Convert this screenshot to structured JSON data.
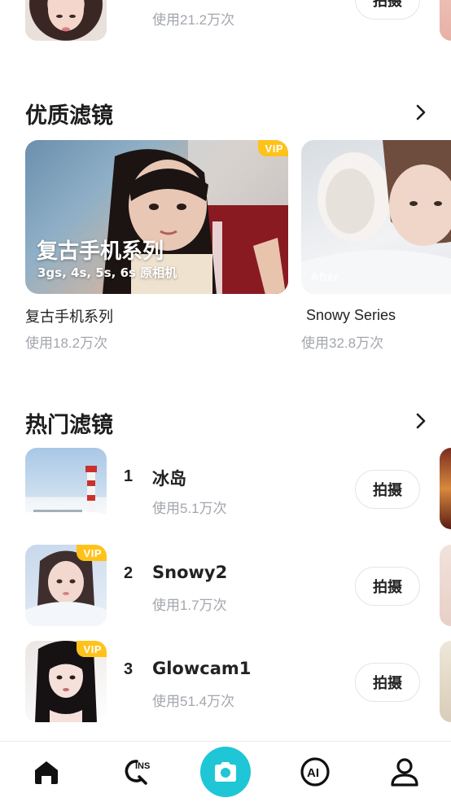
{
  "top_item": {
    "usage": "使用21.2万次",
    "button": "拍摄"
  },
  "quality": {
    "title": "优质滤镜",
    "cards": [
      {
        "banner_title": "复古手机系列",
        "banner_subtitle": "3gs, 4s, 5s, 6s 原相机",
        "badge": "VIP",
        "name": "复古手机系列",
        "usage": "使用18.2万次"
      },
      {
        "overlay": "After",
        "name": "Snowy Series",
        "usage": "使用32.8万次"
      }
    ]
  },
  "hot": {
    "title": "热门滤镜",
    "items": [
      {
        "rank": "1",
        "name": "冰岛",
        "usage": "使用5.1万次",
        "button": "拍摄"
      },
      {
        "rank": "2",
        "name": "Snowy2",
        "usage": "使用1.7万次",
        "button": "拍摄",
        "badge": "VIP"
      },
      {
        "rank": "3",
        "name": "Glowcam1",
        "usage": "使用51.4万次",
        "button": "拍摄",
        "badge": "VIP"
      }
    ]
  },
  "nav": {
    "ins_label": "INS",
    "ai_label": "AI",
    "items": [
      "home-icon",
      "ins-search-icon",
      "camera-icon",
      "ai-icon",
      "profile-icon"
    ]
  },
  "colors": {
    "accent": "#1fc6d6",
    "vip": "#ffc21a",
    "muted": "#a3a6ad"
  }
}
